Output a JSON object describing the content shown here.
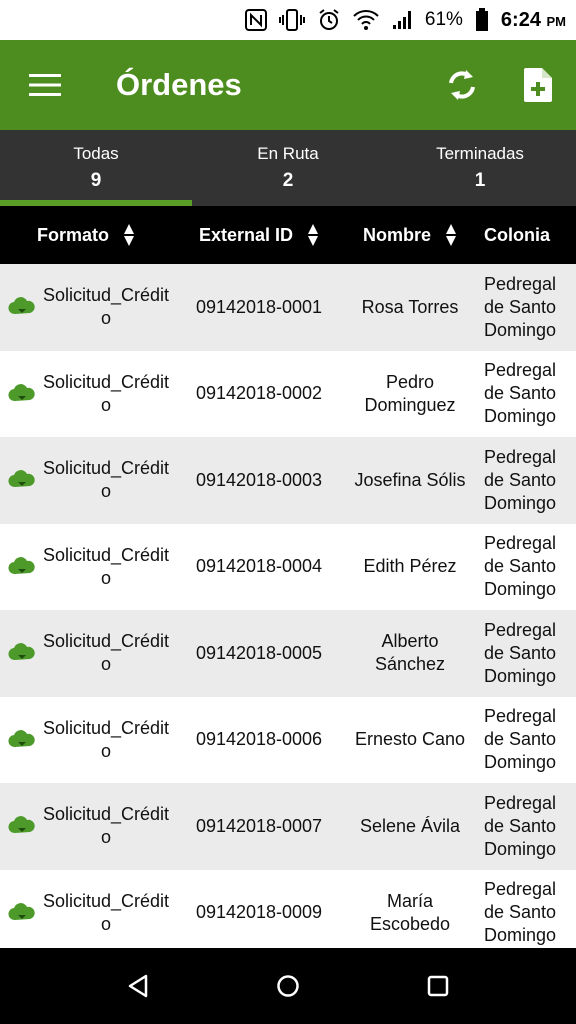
{
  "status_bar": {
    "battery": "61%",
    "time": "6:24",
    "ampm": "PM",
    "icons": [
      "nfc-icon",
      "vibrate-icon",
      "alarm-icon",
      "wifi-icon",
      "signal-icon",
      "battery-icon"
    ]
  },
  "app_bar": {
    "title": "Órdenes",
    "icons": [
      "menu-icon",
      "refresh-icon",
      "new-document-icon"
    ],
    "color": "#4d8c1e"
  },
  "tabs": [
    {
      "label": "Todas",
      "count": "9",
      "active": true
    },
    {
      "label": "En Ruta",
      "count": "2",
      "active": false
    },
    {
      "label": "Terminadas",
      "count": "1",
      "active": false
    }
  ],
  "table": {
    "headers": [
      "Formato",
      "External ID",
      "Nombre",
      "Colonia"
    ],
    "rows": [
      {
        "formato": "Solicitud_Crédito",
        "external_id": "09142018-0001",
        "nombre": "Rosa Torres",
        "colonia": "Pedregal de Santo Domingo"
      },
      {
        "formato": "Solicitud_Crédito",
        "external_id": "09142018-0002",
        "nombre": "Pedro Dominguez",
        "colonia": "Pedregal de Santo Domingo"
      },
      {
        "formato": "Solicitud_Crédito",
        "external_id": "09142018-0003",
        "nombre": "Josefina Sólis",
        "colonia": "Pedregal de Santo Domingo"
      },
      {
        "formato": "Solicitud_Crédito",
        "external_id": "09142018-0004",
        "nombre": "Edith Pérez",
        "colonia": "Pedregal de Santo Domingo"
      },
      {
        "formato": "Solicitud_Crédito",
        "external_id": "09142018-0005",
        "nombre": "Alberto Sánchez",
        "colonia": "Pedregal de Santo Domingo"
      },
      {
        "formato": "Solicitud_Crédito",
        "external_id": "09142018-0006",
        "nombre": "Ernesto Cano",
        "colonia": "Pedregal de Santo Domingo"
      },
      {
        "formato": "Solicitud_Crédito",
        "external_id": "09142018-0007",
        "nombre": "Selene Ávila",
        "colonia": "Pedregal de Santo Domingo"
      },
      {
        "formato": "Solicitud_Crédito",
        "external_id": "09142018-0009",
        "nombre": "María Escobedo",
        "colonia": "Pedregal de Santo Domingo"
      }
    ]
  },
  "nav_bar": {
    "icons": [
      "back-icon",
      "home-icon",
      "recents-icon"
    ]
  }
}
